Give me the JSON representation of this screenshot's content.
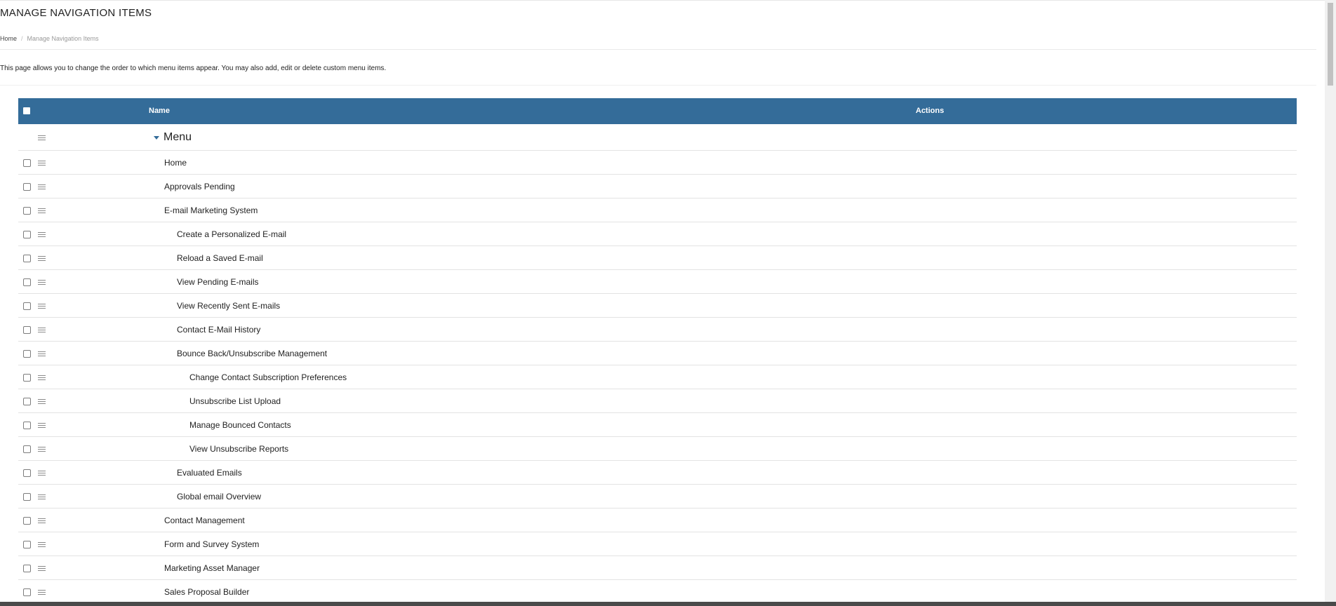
{
  "page": {
    "title": "MANAGE NAVIGATION ITEMS",
    "breadcrumb": {
      "home": "Home",
      "separator": "/",
      "current": "Manage Navigation Items"
    },
    "description": "This page allows you to change the order to which menu items appear. You may also add, edit or delete custom menu items."
  },
  "table": {
    "header": {
      "name": "Name",
      "actions": "Actions",
      "header_color": "#346c99"
    },
    "root_label": "Menu",
    "items": [
      {
        "label": "Home",
        "level": 1
      },
      {
        "label": "Approvals Pending",
        "level": 1
      },
      {
        "label": "E-mail Marketing System",
        "level": 1
      },
      {
        "label": "Create a Personalized E-mail",
        "level": 2
      },
      {
        "label": "Reload a Saved E-mail",
        "level": 2
      },
      {
        "label": "View Pending E-mails",
        "level": 2
      },
      {
        "label": "View Recently Sent E-mails",
        "level": 2
      },
      {
        "label": "Contact E-Mail History",
        "level": 2
      },
      {
        "label": "Bounce Back/Unsubscribe Management",
        "level": 2
      },
      {
        "label": "Change Contact Subscription Preferences",
        "level": 3
      },
      {
        "label": "Unsubscribe List Upload",
        "level": 3
      },
      {
        "label": "Manage Bounced Contacts",
        "level": 3
      },
      {
        "label": "View Unsubscribe Reports",
        "level": 3
      },
      {
        "label": "Evaluated Emails",
        "level": 2
      },
      {
        "label": "Global email Overview",
        "level": 2
      },
      {
        "label": "Contact Management",
        "level": 1
      },
      {
        "label": "Form and Survey System",
        "level": 1
      },
      {
        "label": "Marketing Asset Manager",
        "level": 1
      },
      {
        "label": "Sales Proposal Builder",
        "level": 1
      }
    ]
  }
}
